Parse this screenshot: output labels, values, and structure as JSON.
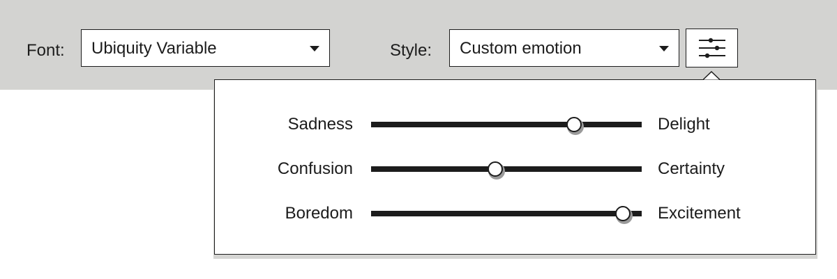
{
  "toolbar": {
    "font_label": "Font:",
    "font_value": "Ubiquity Variable",
    "style_label": "Style:",
    "style_value": "Custom emotion",
    "settings_icon": "sliders-icon"
  },
  "popover": {
    "sliders": [
      {
        "left": "Sadness",
        "right": "Delight",
        "value": 0.75
      },
      {
        "left": "Confusion",
        "right": "Certainty",
        "value": 0.46
      },
      {
        "left": "Boredom",
        "right": "Excitement",
        "value": 0.93
      }
    ]
  },
  "colors": {
    "toolbar_bg": "#d3d3d1",
    "ink": "#1c1c1c",
    "popover_bg": "#ffffff"
  }
}
